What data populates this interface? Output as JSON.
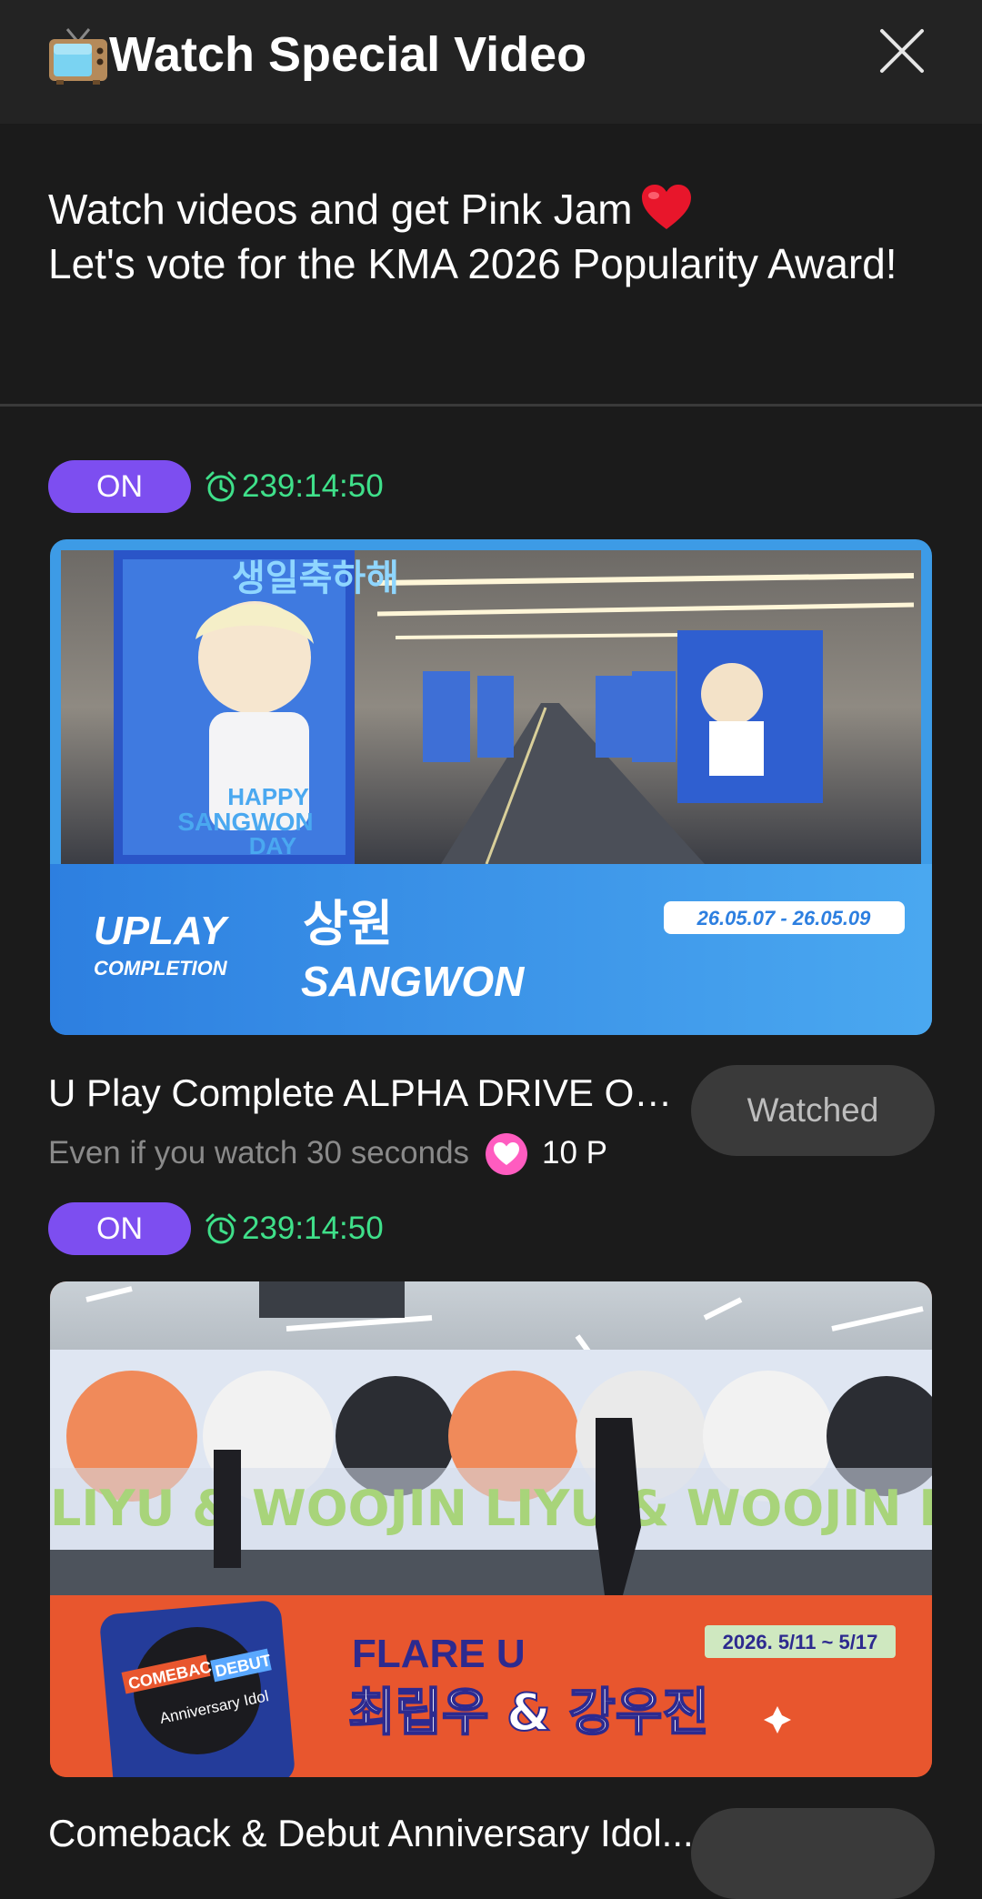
{
  "header": {
    "tv_icon": "tv-icon",
    "title": "Watch Special Video",
    "close_icon": "close-icon"
  },
  "intro": {
    "line1": "Watch videos and get Pink Jam",
    "heart_icon": "red-heart-icon",
    "line2": "Let's vote for the KMA 2026 Popularity Award!"
  },
  "videos": [
    {
      "status": "ON",
      "timer": "239:14:50",
      "thumbnail": {
        "banner_title": "UPLAY",
        "banner_sub": "COMPLETION",
        "name_kr": "상원",
        "name_en": "SANGWON",
        "dates": "26.05.07 - 26.05.09",
        "screen_text_1": "생일축하해",
        "screen_text_2": "HAPPY",
        "screen_text_3": "SANGWON",
        "screen_text_4": "DAY"
      },
      "title": "U Play Complete ALPHA DRIVE ON...",
      "reward_text": "Even if you watch 30 seconds",
      "points": "10 P",
      "button": "Watched"
    },
    {
      "status": "ON",
      "timer": "239:14:50",
      "thumbnail": {
        "wall_text": "LIYU & WOOJIN LIYU & WOOJIN LIYU & WOOJIN",
        "brand": "FLARE U",
        "names_kr": "최립우 & 강우진",
        "dates": "2026. 5/11 ~ 5/17",
        "badge_1": "COMEBACK",
        "badge_2": "DEBUT",
        "badge_3": "Anniversary Idol"
      },
      "title": "Comeback & Debut Anniversary Idol..."
    }
  ],
  "colors": {
    "on_pill": "#7d4ef0",
    "timer": "#3fe08a",
    "pink_icon": "#ff5cc0"
  }
}
